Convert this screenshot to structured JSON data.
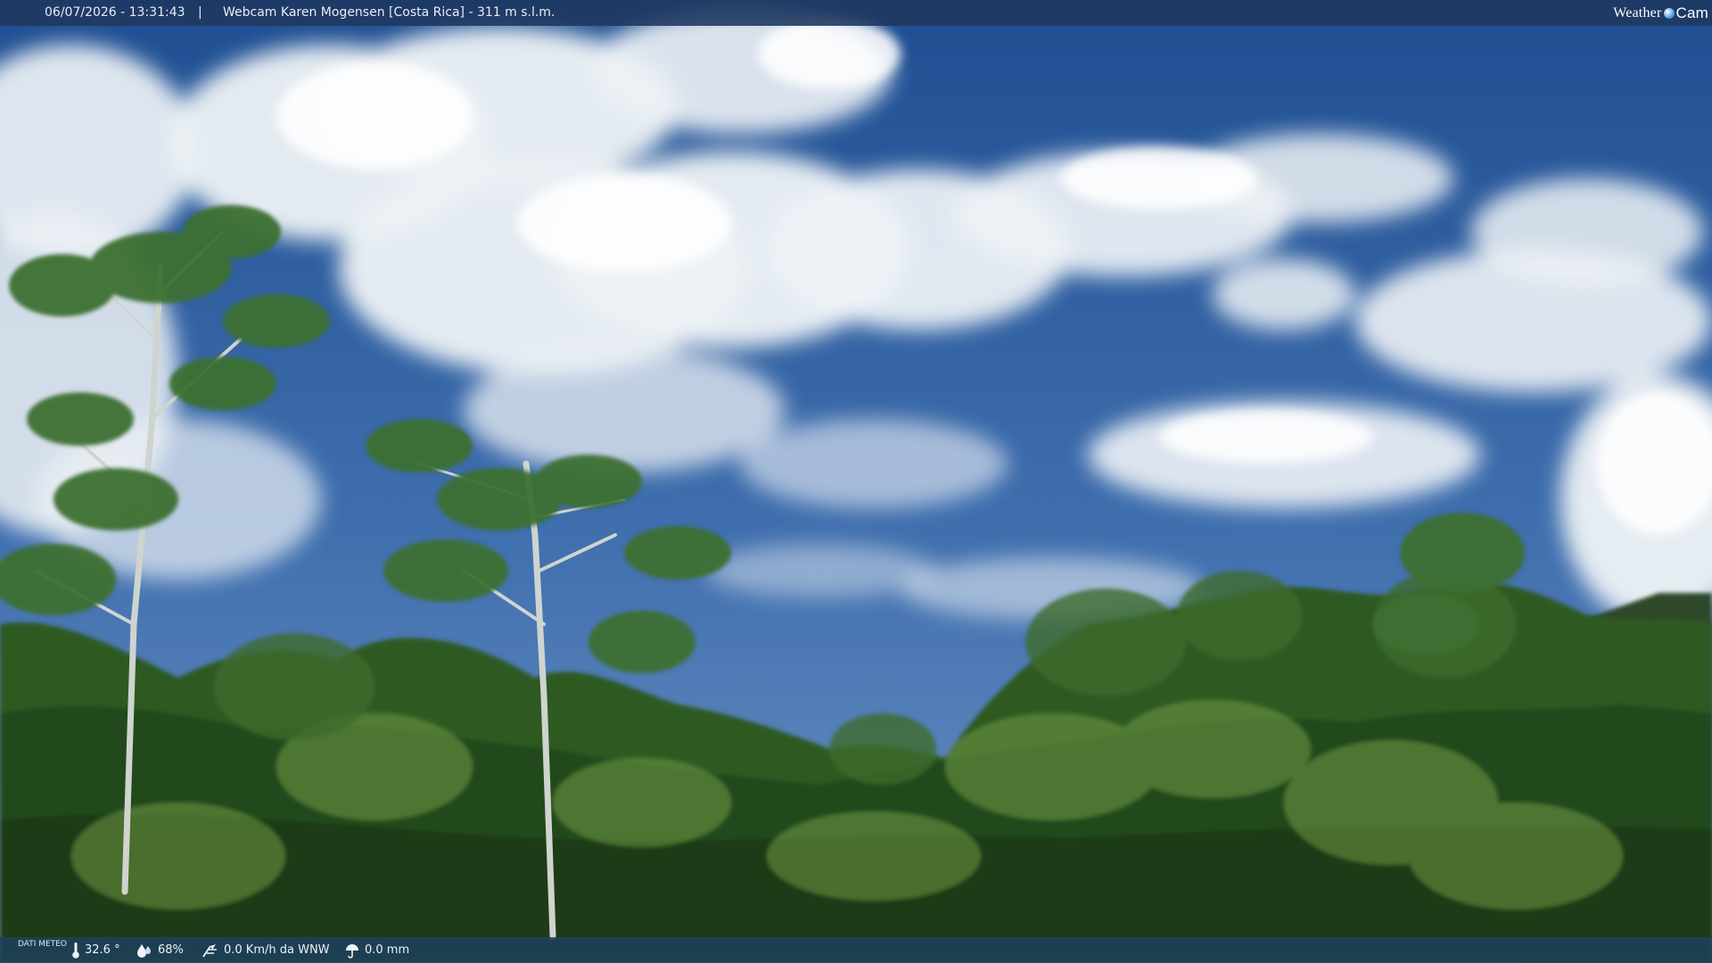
{
  "header": {
    "timestamp": "06/07/2026 - 13:31:43",
    "separator": "|",
    "title": "Webcam Karen Mogensen [Costa Rica] - 311 m s.l.m.",
    "logo": {
      "word1": "Weather",
      "word2": "Cam",
      "icon": "globe-dot-icon"
    }
  },
  "weather": {
    "label": "DATI METEO",
    "temperature": "32.6 °",
    "humidity": "68%",
    "wind": "0.0 Km/h da WNW",
    "rain": "0.0 mm",
    "icons": [
      "thermometer-icon",
      "humidity-drop-icon",
      "wind-icon",
      "rain-icon"
    ]
  },
  "colors": {
    "sky_top": "#1f4f92",
    "sky_bottom": "#6d93c4",
    "foliage_dark": "#1f3d18",
    "foliage_light": "#5c8a3a",
    "bar_bg": "#1e375f"
  }
}
